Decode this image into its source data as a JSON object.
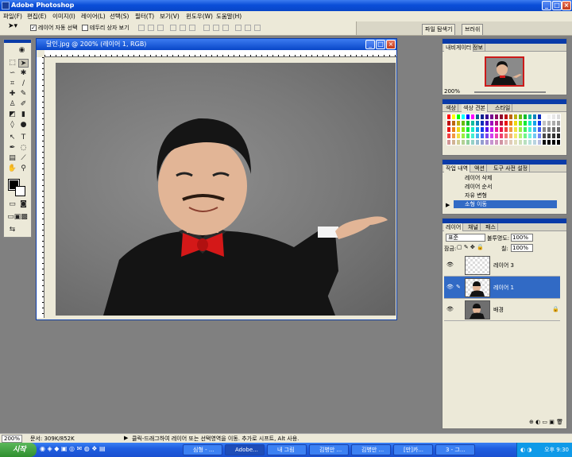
{
  "app": {
    "title": "Adobe Photoshop"
  },
  "menu": [
    "파일(F)",
    "편집(E)",
    "이미지(I)",
    "레이어(L)",
    "선택(S)",
    "필터(T)",
    "보기(V)",
    "윈도우(W)",
    "도움말(H)"
  ],
  "options": {
    "auto_select_label": "레이어 자동 선택",
    "bounding_box_label": "테두리 상자 보기",
    "auto_select_checked": true
  },
  "palette_well": {
    "tabs": [
      "파일 탐색기",
      "브러쉬"
    ]
  },
  "document": {
    "title": "달인.jpg @ 200% (레이어 1, RGB)"
  },
  "navigator": {
    "tabs": [
      "내비게이터",
      "정보"
    ],
    "zoom": "200%"
  },
  "swatches": {
    "tabs": [
      "색상",
      "색상 견본",
      "스타일"
    ]
  },
  "history": {
    "tabs": [
      "작업 내역",
      "액션",
      "도구 사전 설정"
    ],
    "items": [
      "레이어 삭제",
      "레이어 순서",
      "자유 변형",
      "소형 이동"
    ],
    "selected_index": 3
  },
  "layers": {
    "tabs": [
      "레이어",
      "채널",
      "패스"
    ],
    "blend_mode": "표준",
    "opacity_label": "불투명도:",
    "opacity": "100%",
    "lock_label": "잠금:",
    "fill_label": "칠:",
    "fill": "100%",
    "items": [
      {
        "name": "레이어 3",
        "selected": false
      },
      {
        "name": "레이어 1",
        "selected": true
      },
      {
        "name": "배경",
        "selected": false
      }
    ]
  },
  "status": {
    "zoom": "200%",
    "doc": "문서: 309K/852K",
    "hint": "클릭-드래그하여 레이어 또는 선택영역을 이동. 추가로 시프트, Alt 사용."
  },
  "taskbar": {
    "start": "시작",
    "tasks": [
      "심형 - ...",
      "Adobe...",
      "내 그림",
      "김병만 ...",
      "김병만 ...",
      "[만]카...",
      "3 - 그..."
    ],
    "active_index": 1,
    "clock": "오후 9:30"
  },
  "colors": {
    "xp_blue": "#0a4ed8",
    "canvas_bg": "#808080",
    "selection": "#316ac5"
  }
}
